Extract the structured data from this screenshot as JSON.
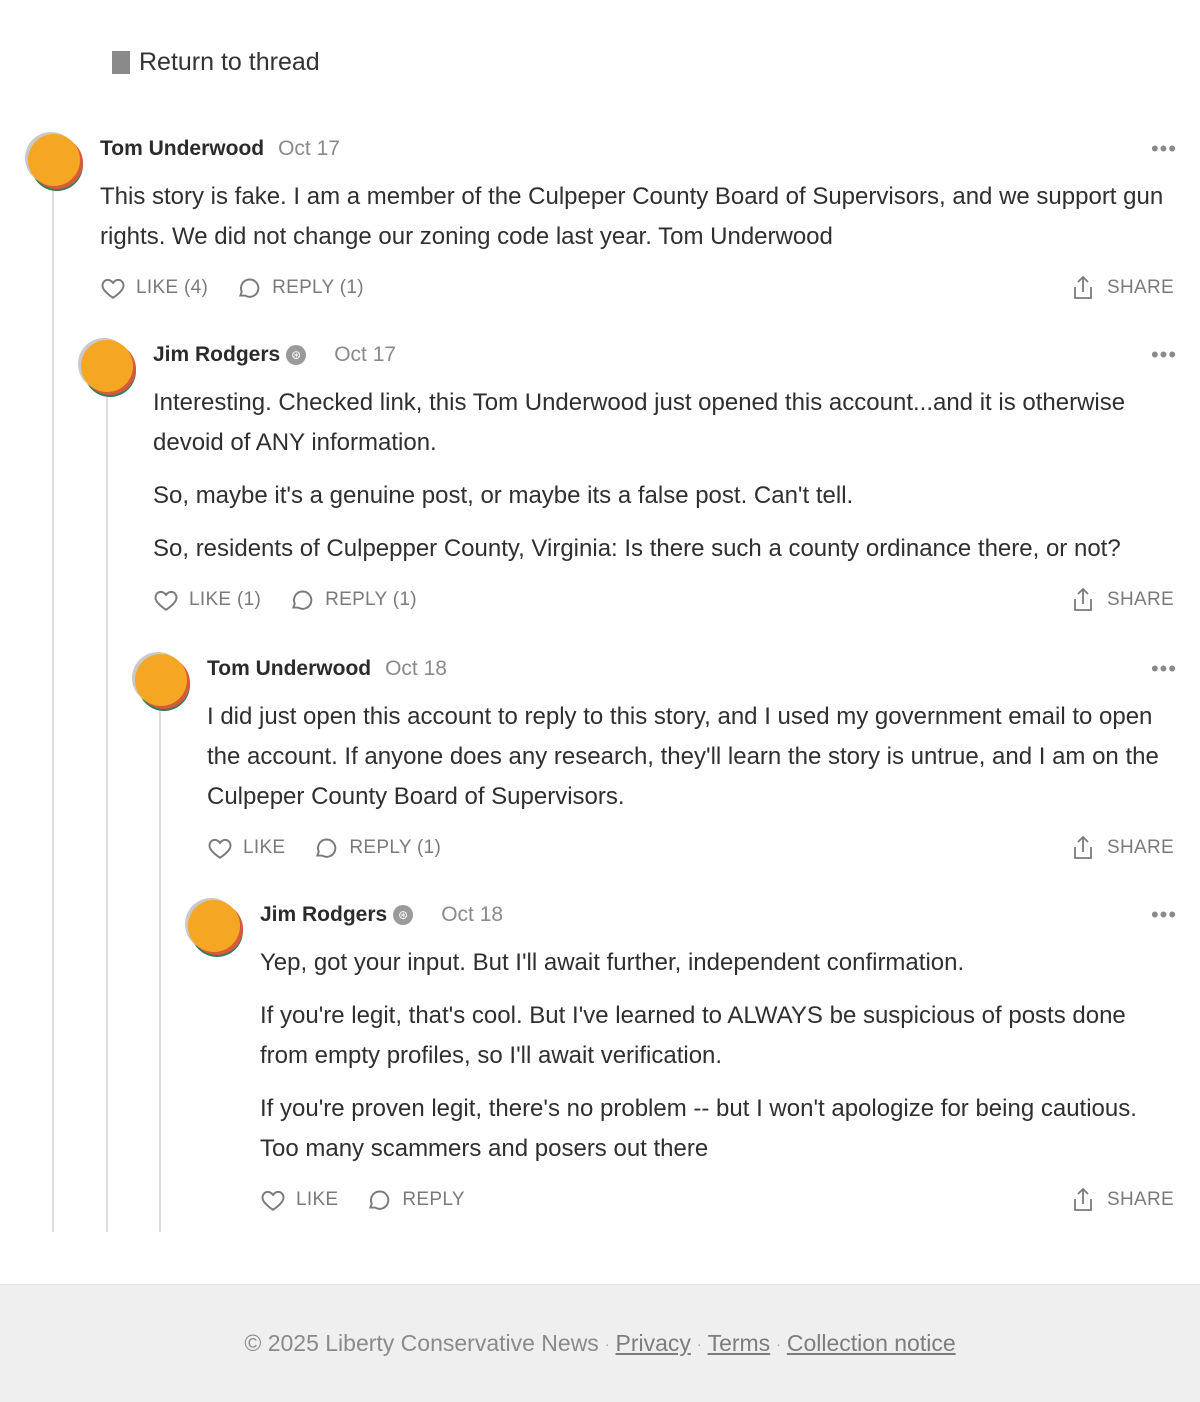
{
  "nav": {
    "return_label": "Return to thread"
  },
  "comments": [
    {
      "author": "Tom Underwood",
      "date": "Oct 17",
      "paragraphs": [
        "This story is fake. I am a member of the Culpeper County Board of Supervisors, and we support gun rights. We did not change our zoning code last year. Tom Underwood"
      ],
      "like_label": "LIKE (4)",
      "reply_label": "REPLY (1)",
      "share_label": "SHARE",
      "more_label": "•••"
    },
    {
      "author": "Jim Rodgers",
      "badge": "⊛",
      "date": "Oct 17",
      "paragraphs": [
        "Interesting. Checked link, this Tom Underwood just opened this account...and it is otherwise devoid of ANY information.",
        "So, maybe it's a genuine post, or maybe its a false post. Can't tell.",
        "So, residents of Culpepper County, Virginia: Is there such a county ordinance there, or not?"
      ],
      "like_label": "LIKE (1)",
      "reply_label": "REPLY (1)",
      "share_label": "SHARE",
      "more_label": "•••"
    },
    {
      "author": "Tom Underwood",
      "date": "Oct 18",
      "paragraphs": [
        "I did just open this account to reply to this story, and I used my government email to open the account. If anyone does any research, they'll learn the story is untrue, and I am on the Culpeper County Board of Supervisors."
      ],
      "like_label": "LIKE",
      "reply_label": "REPLY (1)",
      "share_label": "SHARE",
      "more_label": "•••"
    },
    {
      "author": "Jim Rodgers",
      "badge": "⊛",
      "date": "Oct 18",
      "paragraphs": [
        "Yep, got your input. But I'll await further, independent confirmation.",
        "If you're legit, that's cool. But I've learned to ALWAYS be suspicious of posts done from empty profiles, so I'll await verification.",
        "If you're proven legit, there's no problem -- but I won't apologize for being cautious. Too many scammers and posers out there"
      ],
      "like_label": "LIKE",
      "reply_label": "REPLY",
      "share_label": "SHARE",
      "more_label": "•••"
    }
  ],
  "footer": {
    "copyright": "© 2025 Liberty Conservative News",
    "separator": "·",
    "privacy": "Privacy",
    "terms": "Terms",
    "collection": "Collection notice"
  },
  "colors": {
    "avatar": "#f5a623",
    "accent_red": "#d85a3a",
    "accent_green": "#2f7d5a",
    "footer_bg": "#efefef"
  }
}
